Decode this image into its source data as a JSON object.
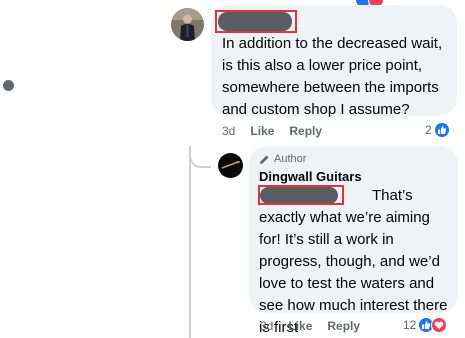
{
  "comment": {
    "text": "In addition to the decreased wait, is this also a lower price point, somewhere between the imports and custom shop I assume?",
    "time": "3d",
    "like_label": "Like",
    "reply_label": "Reply",
    "reaction_count": "2"
  },
  "reply": {
    "badge": "Author",
    "author": "Dingwall Guitars",
    "text": "That’s exactly what we’re aiming for! It’s still a work in progress, though, and we’d love to test the waters and see how much interest there is first",
    "time": "3d",
    "like_label": "Like",
    "reply_label": "Reply",
    "reaction_count": "12"
  },
  "colors": {
    "bubble": "#f0f2f5",
    "like": "#1877f2",
    "love": "#f33e58",
    "redaction_box": "#e0353a"
  },
  "icons": [
    "like-icon",
    "love-icon",
    "pencil-icon",
    "avatar"
  ]
}
